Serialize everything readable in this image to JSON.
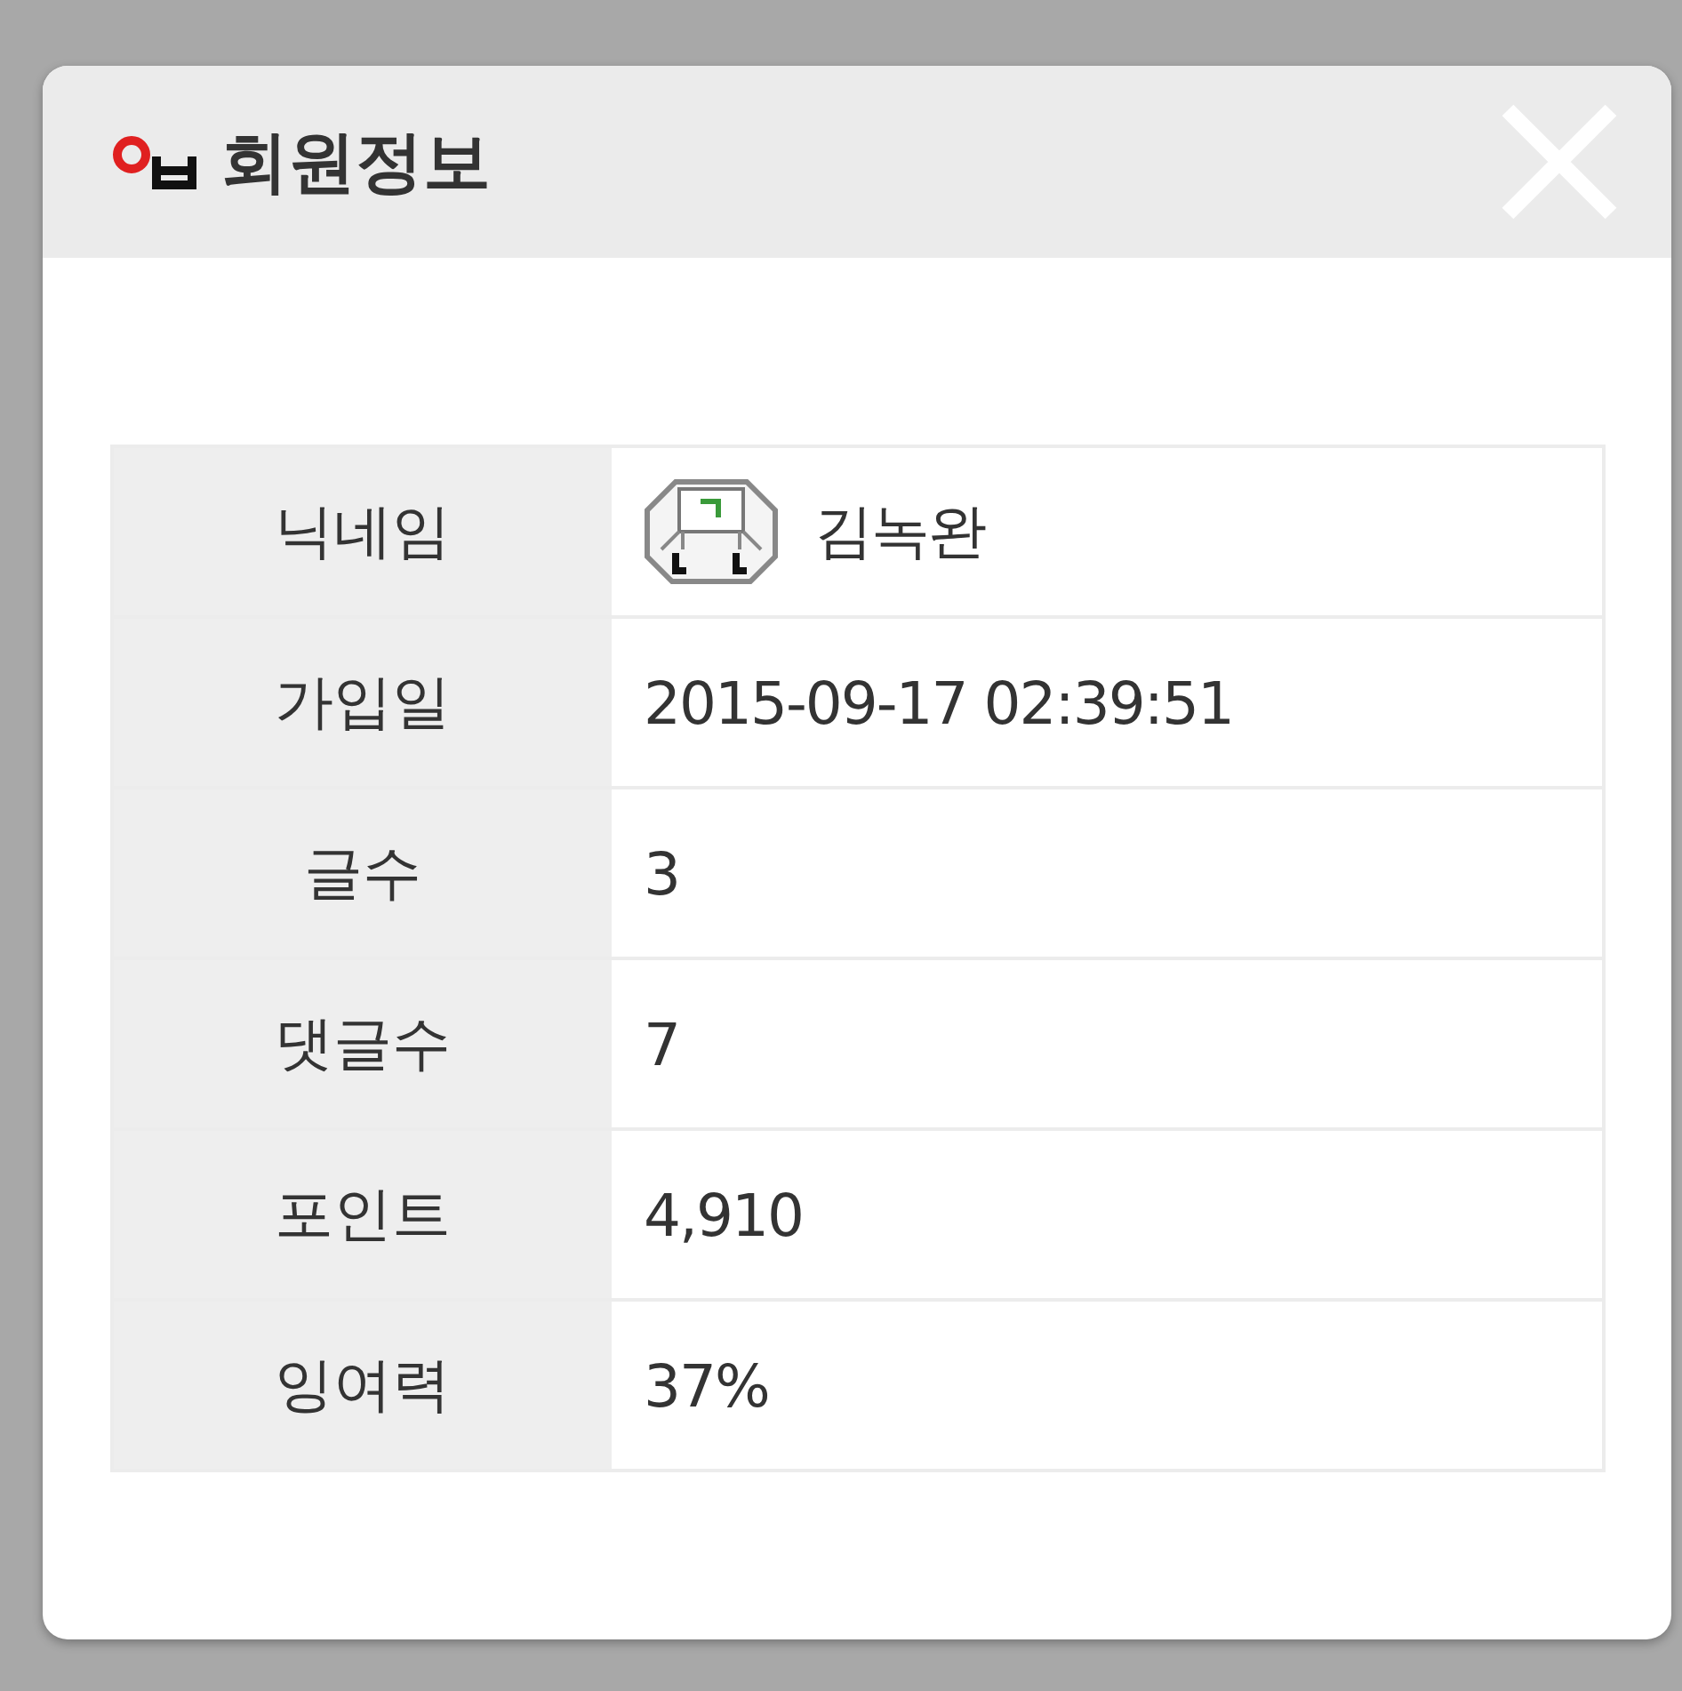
{
  "dialog": {
    "title": "회원정보"
  },
  "rows": [
    {
      "label": "닉네임",
      "value": "김녹완",
      "kind": "avatar"
    },
    {
      "label": "가입일",
      "value": "2015-09-17 02:39:51",
      "kind": "text"
    },
    {
      "label": "글수",
      "value": "3",
      "kind": "text"
    },
    {
      "label": "댓글수",
      "value": "7",
      "kind": "text"
    },
    {
      "label": "포인트",
      "value": "4,910",
      "kind": "text"
    },
    {
      "label": "잉여력",
      "value": "37%",
      "kind": "text"
    }
  ]
}
